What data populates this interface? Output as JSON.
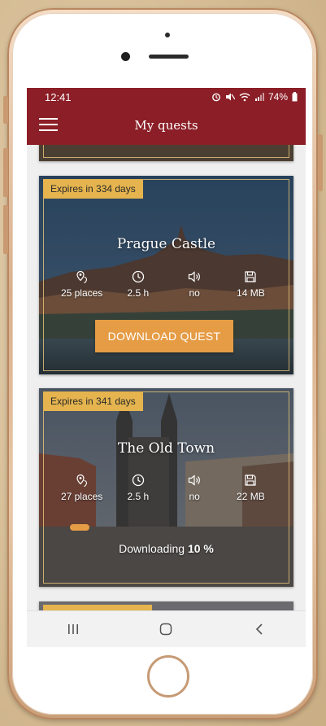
{
  "status_bar": {
    "time": "12:41",
    "battery": "74%"
  },
  "app_bar": {
    "title": "My quests"
  },
  "quests": [
    {
      "badge": "Expires in 334 days",
      "title": "Prague Castle",
      "places": "25 places",
      "duration": "2.5 h",
      "audio": "no",
      "size": "14 MB",
      "action_label": "DOWNLOAD QUEST"
    },
    {
      "badge": "Expires in 341 days",
      "title": "The Old Town",
      "places": "27 places",
      "duration": "2.5 h",
      "audio": "no",
      "size": "22 MB",
      "downloading_label": "Downloading",
      "downloading_percent": "10 %",
      "progress": 0.1
    }
  ],
  "icons": {
    "menu": "hamburger-icon",
    "places": "places-icon",
    "duration": "clock-icon",
    "audio": "speaker-icon",
    "size": "floppy-disk-icon",
    "nav_recent": "recent-apps-icon",
    "nav_home": "home-icon",
    "nav_back": "back-icon"
  },
  "colors": {
    "primary": "#8b1e26",
    "badge": "#e5b44e",
    "accent": "#e59c45"
  }
}
